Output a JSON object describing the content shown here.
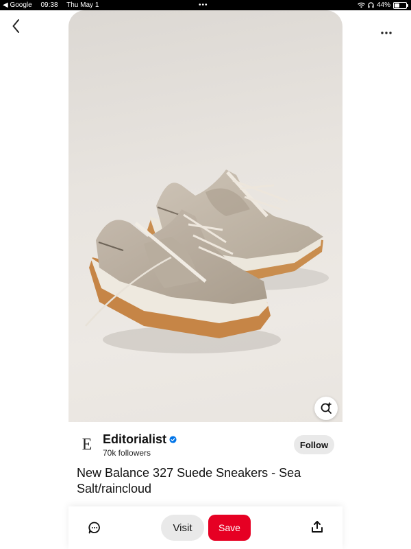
{
  "status_bar": {
    "back_app": "◀ Google",
    "time": "09:38",
    "date": "Thu May 1",
    "dots": "•••",
    "battery_text": "44%",
    "battery_level": 0.44
  },
  "icons": {
    "back": "chevron-left-icon",
    "more": "ellipsis-icon",
    "lens": "visual-search-icon",
    "comment": "comment-icon",
    "share": "share-icon",
    "verified": "verified-badge-icon"
  },
  "pin": {
    "image_alt": "New Balance 327 Suede Sneakers - Sea Salt/raincloud",
    "title": "New Balance 327 Suede Sneakers - Sea Salt/raincloud"
  },
  "creator": {
    "avatar_letter": "E",
    "name": "Editorialist",
    "followers": "70k followers",
    "follow_label": "Follow"
  },
  "actions": {
    "visit_label": "Visit",
    "save_label": "Save"
  },
  "colors": {
    "save": "#e60023",
    "verified": "#0074e8"
  }
}
